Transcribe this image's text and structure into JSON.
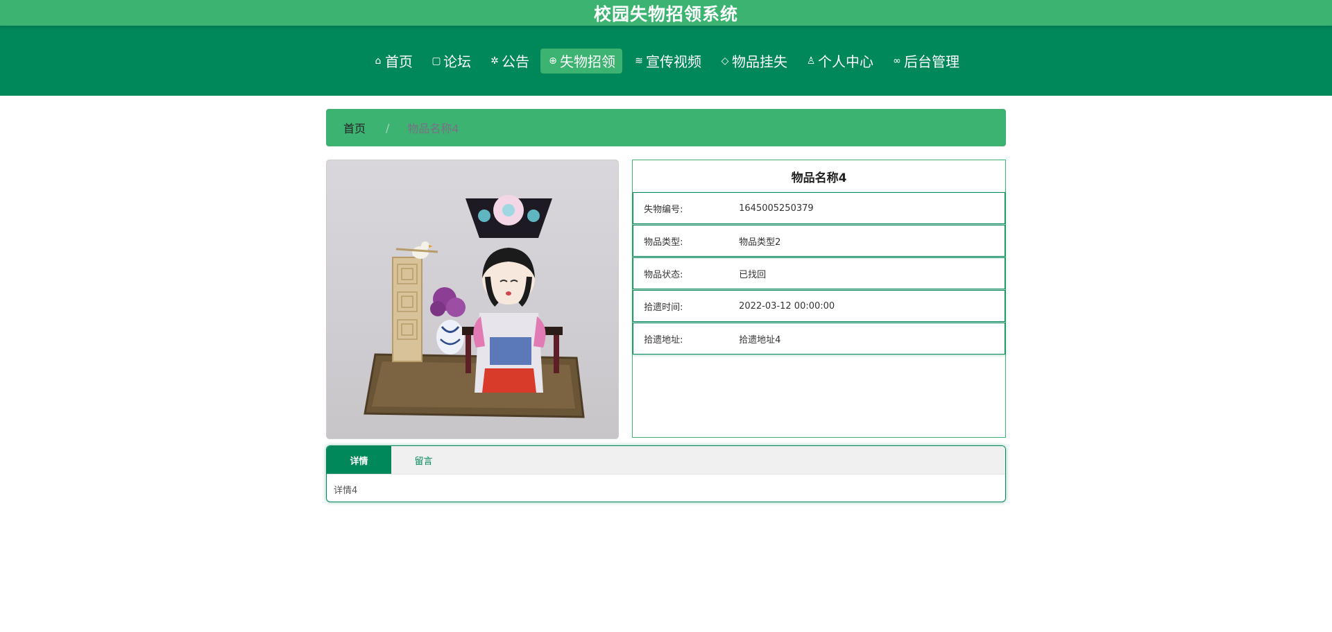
{
  "header": {
    "title": "校园失物招领系统"
  },
  "nav": {
    "items": [
      {
        "icon": "home-icon",
        "glyph": "⌂",
        "label": "首页",
        "active": false
      },
      {
        "icon": "forum-icon",
        "glyph": "▢",
        "label": "论坛",
        "active": false
      },
      {
        "icon": "notice-icon",
        "glyph": "✲",
        "label": "公告",
        "active": false
      },
      {
        "icon": "globe-icon",
        "glyph": "⊕",
        "label": "失物招领",
        "active": true
      },
      {
        "icon": "layers-icon",
        "glyph": "≋",
        "label": "宣传视频",
        "active": false
      },
      {
        "icon": "tag-icon",
        "glyph": "◇",
        "label": "物品挂失",
        "active": false
      },
      {
        "icon": "user-icon",
        "glyph": "♙",
        "label": "个人中心",
        "active": false
      },
      {
        "icon": "link-icon",
        "glyph": "∞",
        "label": "后台管理",
        "active": false
      }
    ]
  },
  "breadcrumb": {
    "home": "首页",
    "separator": "/",
    "current": "物品名称4"
  },
  "item": {
    "name": "物品名称4",
    "fields": [
      {
        "label": "失物编号:",
        "value": "1645005250379"
      },
      {
        "label": "物品类型:",
        "value": "物品类型2"
      },
      {
        "label": "物品状态:",
        "value": "已找回"
      },
      {
        "label": "拾遗时间:",
        "value": "2022-03-12 00:00:00"
      },
      {
        "label": "拾遗地址:",
        "value": "拾遗地址4"
      }
    ]
  },
  "tabs": {
    "items": [
      {
        "label": "详情",
        "active": true
      },
      {
        "label": "留言",
        "active": false
      }
    ],
    "content": "详情4"
  },
  "colors": {
    "primary": "#00875a",
    "accent": "#3cb371"
  }
}
